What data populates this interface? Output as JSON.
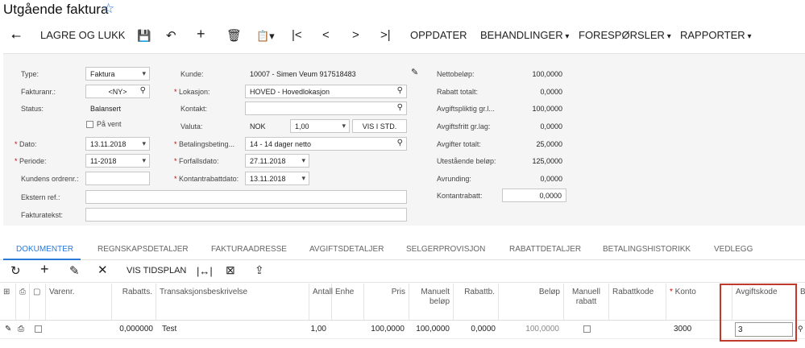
{
  "page": {
    "title": "Utgående faktura",
    "star_icon": "star-icon"
  },
  "toolbar": {
    "save_close": "LAGRE OG LUKK",
    "refresh": "OPPDATER",
    "actions": "BEHANDLINGER",
    "inquiries": "FORESPØRSLER",
    "reports": "RAPPORTER"
  },
  "form": {
    "type_label": "Type:",
    "type_value": "Faktura",
    "ref_label": "Fakturanr.:",
    "ref_value": "<NY>",
    "status_label": "Status:",
    "status_value": "Balansert",
    "hold_label": "På vent",
    "date_label": "Dato:",
    "date_value": "13.11.2018",
    "period_label": "Periode:",
    "period_value": "11-2018",
    "cust_order_label": "Kundens ordrenr.:",
    "ext_ref_label": "Ekstern ref.:",
    "desc_label": "Fakturatekst:",
    "customer_label": "Kunde:",
    "customer_value": "10007 - Simen Veum 917518483",
    "location_label": "Lokasjon:",
    "location_value": "HOVED - Hovedlokasjon",
    "contact_label": "Kontakt:",
    "currency_label": "Valuta:",
    "currency_value": "NOK",
    "rate_value": "1,00",
    "rate_button": "VIS I STD.",
    "terms_label": "Betalingsbeting...",
    "terms_value": "14 - 14 dager netto",
    "due_label": "Forfallsdato:",
    "due_value": "27.11.2018",
    "disc_date_label": "Kontantrabattdato:",
    "disc_date_value": "13.11.2018",
    "totals": [
      {
        "label": "Nettobeløp:",
        "value": "100,0000"
      },
      {
        "label": "Rabatt totalt:",
        "value": "0,0000"
      },
      {
        "label": "Avgiftspliktig gr.l...",
        "value": "100,0000"
      },
      {
        "label": "Avgiftsfritt gr.lag:",
        "value": "0,0000"
      },
      {
        "label": "Avgifter totalt:",
        "value": "25,0000"
      },
      {
        "label": "Utestående beløp:",
        "value": "125,0000"
      },
      {
        "label": "Avrunding:",
        "value": "0,0000"
      },
      {
        "label": "Kontantrabatt:",
        "value": "0,0000"
      }
    ]
  },
  "tabs": [
    "DOKUMENTER",
    "REGNSKAPSDETALJER",
    "FAKTURAADRESSE",
    "AVGIFTSDETALJER",
    "SELGERPROVISJON",
    "RABATTDETALJER",
    "BETALINGSHISTORIKK",
    "VEDLEGG"
  ],
  "grid_toolbar": {
    "schedule": "VIS TIDSPLAN"
  },
  "columns": {
    "item": "Varenr.",
    "disc": "Rabatts.",
    "desc": "Transaksjonsbeskrivelse",
    "qty": "Antall",
    "uom": "Enhe",
    "price": "Pris",
    "manual_amt": "Manuelt beløp",
    "disc_amt": "Rabattb.",
    "amount": "Beløp",
    "manual_disc": "Manuell rabatt",
    "disc_code": "Rabattkode",
    "account": "Konto",
    "tax": "Avgiftskode",
    "extra": "B"
  },
  "row": {
    "disc": "0,000000",
    "desc": "Test",
    "qty": "1,00",
    "price": "100,0000",
    "manual_amt": "100,0000",
    "disc_amt": "0,0000",
    "amount": "100,0000",
    "account": "3000",
    "tax": "3"
  }
}
